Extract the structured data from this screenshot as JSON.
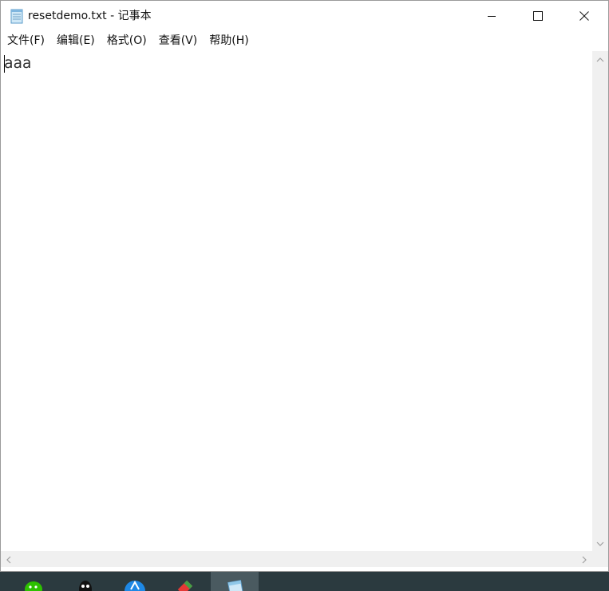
{
  "window": {
    "title": "resetdemo.txt - 记事本",
    "icon": "notepad-icon",
    "controls": {
      "minimize": "minimize-icon",
      "maximize": "maximize-icon",
      "close": "close-icon"
    }
  },
  "menubar": {
    "items": [
      {
        "label": "文件(F)"
      },
      {
        "label": "编辑(E)"
      },
      {
        "label": "格式(O)"
      },
      {
        "label": "查看(V)"
      },
      {
        "label": "帮助(H)"
      }
    ]
  },
  "editor": {
    "content": "aaa"
  },
  "taskbar": {
    "apps": [
      {
        "icon": "wechat-icon",
        "color": "#2dc100"
      },
      {
        "icon": "qq-icon",
        "color": "#111111"
      },
      {
        "icon": "app-store-icon",
        "color": "#1e88e5"
      },
      {
        "icon": "pencil-app-icon",
        "color": "#e53935"
      },
      {
        "icon": "notepad-icon",
        "color": "#8fc7e8",
        "active": true
      }
    ]
  }
}
